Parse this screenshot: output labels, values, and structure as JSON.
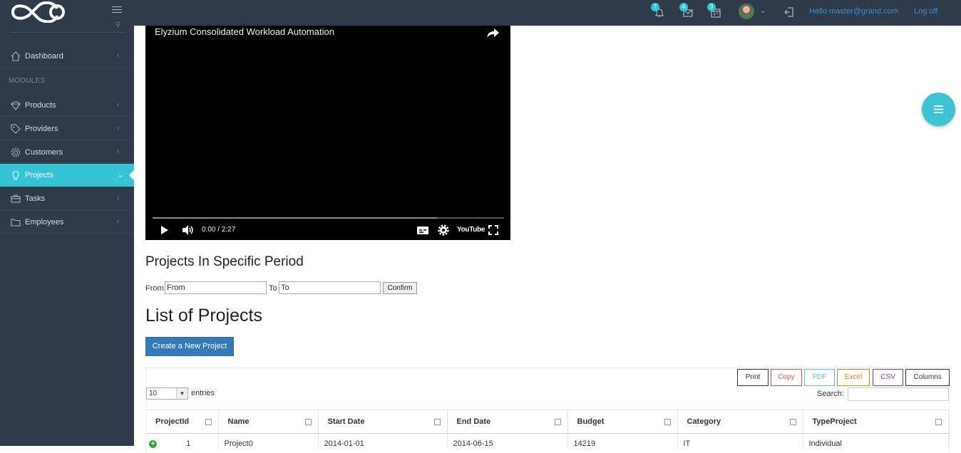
{
  "header": {
    "greeting": "Hello master@grand.com",
    "logoff": "Log off",
    "notifications": [
      {
        "icon": "bell-icon",
        "count": "7"
      },
      {
        "icon": "mail-icon",
        "count": "4"
      },
      {
        "icon": "calendar-icon",
        "count": "3"
      }
    ]
  },
  "sidebar": {
    "section_header": "MODULES",
    "items": [
      {
        "label": "Dashboard",
        "icon": "home-icon"
      },
      {
        "label": "Products",
        "icon": "diamond-icon"
      },
      {
        "label": "Providers",
        "icon": "tag-icon"
      },
      {
        "label": "Customers",
        "icon": "gear-icon"
      },
      {
        "label": "Projects",
        "icon": "lightbulb-icon",
        "active": true
      },
      {
        "label": "Tasks",
        "icon": "briefcase-icon"
      },
      {
        "label": "Employees",
        "icon": "folder-icon"
      }
    ]
  },
  "video": {
    "title": "Elyzium Consolidated Workload Automation",
    "time": "0:00 / 2:27",
    "progress": 0.81,
    "logo_text": "YouTube"
  },
  "period": {
    "heading": "Projects In Specific Period",
    "from_label": "From",
    "from_value": "From",
    "to_label": "To",
    "to_value": "To",
    "confirm": "Confirm"
  },
  "list": {
    "heading": "List of Projects",
    "create_button": "Create a New Project",
    "export_buttons": [
      {
        "label": "Print",
        "color": "#333333"
      },
      {
        "label": "Copy",
        "color": "#d9534f"
      },
      {
        "label": "PDF",
        "color": "#5bc0de"
      },
      {
        "label": "Excel",
        "color": "#d58512"
      },
      {
        "label": "CSV",
        "color": "#7b3fa0"
      },
      {
        "label": "Columns",
        "color": "#333333"
      }
    ],
    "page_length": "10",
    "entries_label": "entries",
    "search_label": "Search:",
    "columns": [
      "ProjectId",
      "Name",
      "Start Date",
      "End Date",
      "Budget",
      "Category",
      "TypeProject"
    ],
    "rows": [
      [
        "1",
        "Project0",
        "2014-01-01",
        "2014-06-15",
        "14219",
        "IT",
        "Individual"
      ]
    ]
  }
}
